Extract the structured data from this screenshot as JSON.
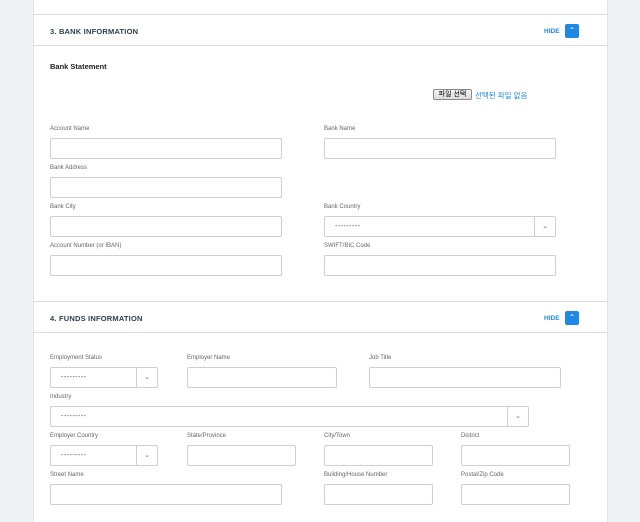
{
  "bank": {
    "title": "3. BANK INFORMATION",
    "hide_label": "HIDE",
    "statement_label": "Bank Statement",
    "file_button": "파일 선택",
    "file_status": "선택된 파일 없음",
    "account_name_label": "Account Name",
    "bank_name_label": "Bank Name",
    "bank_address_label": "Bank Address",
    "bank_city_label": "Bank City",
    "bank_country_label": "Bank Country",
    "bank_country_value": "---------",
    "account_number_label": "Account Number (or IBAN)",
    "swift_label": "SWIFT/BIC Code"
  },
  "funds": {
    "title": "4. FUNDS INFORMATION",
    "hide_label": "HIDE",
    "employment_status_label": "Employment Status",
    "employment_status_value": "---------",
    "employer_name_label": "Employer Name",
    "job_title_label": "Job Title",
    "industry_label": "Industry",
    "industry_value": "---------",
    "employer_country_label": "Employer Country",
    "employer_country_value": "---------",
    "state_label": "State/Province",
    "city_label": "City/Town",
    "district_label": "District",
    "street_label": "Street Name",
    "building_label": "Building/House Number",
    "postal_label": "Postal/Zip Code"
  },
  "icons": {
    "collapse": "chevron-up-icon",
    "dropdown": "chevron-down-icon"
  },
  "colors": {
    "accent": "#1e88e5",
    "background": "#eef2f5",
    "card": "#ffffff",
    "border": "#c9d0d6"
  }
}
